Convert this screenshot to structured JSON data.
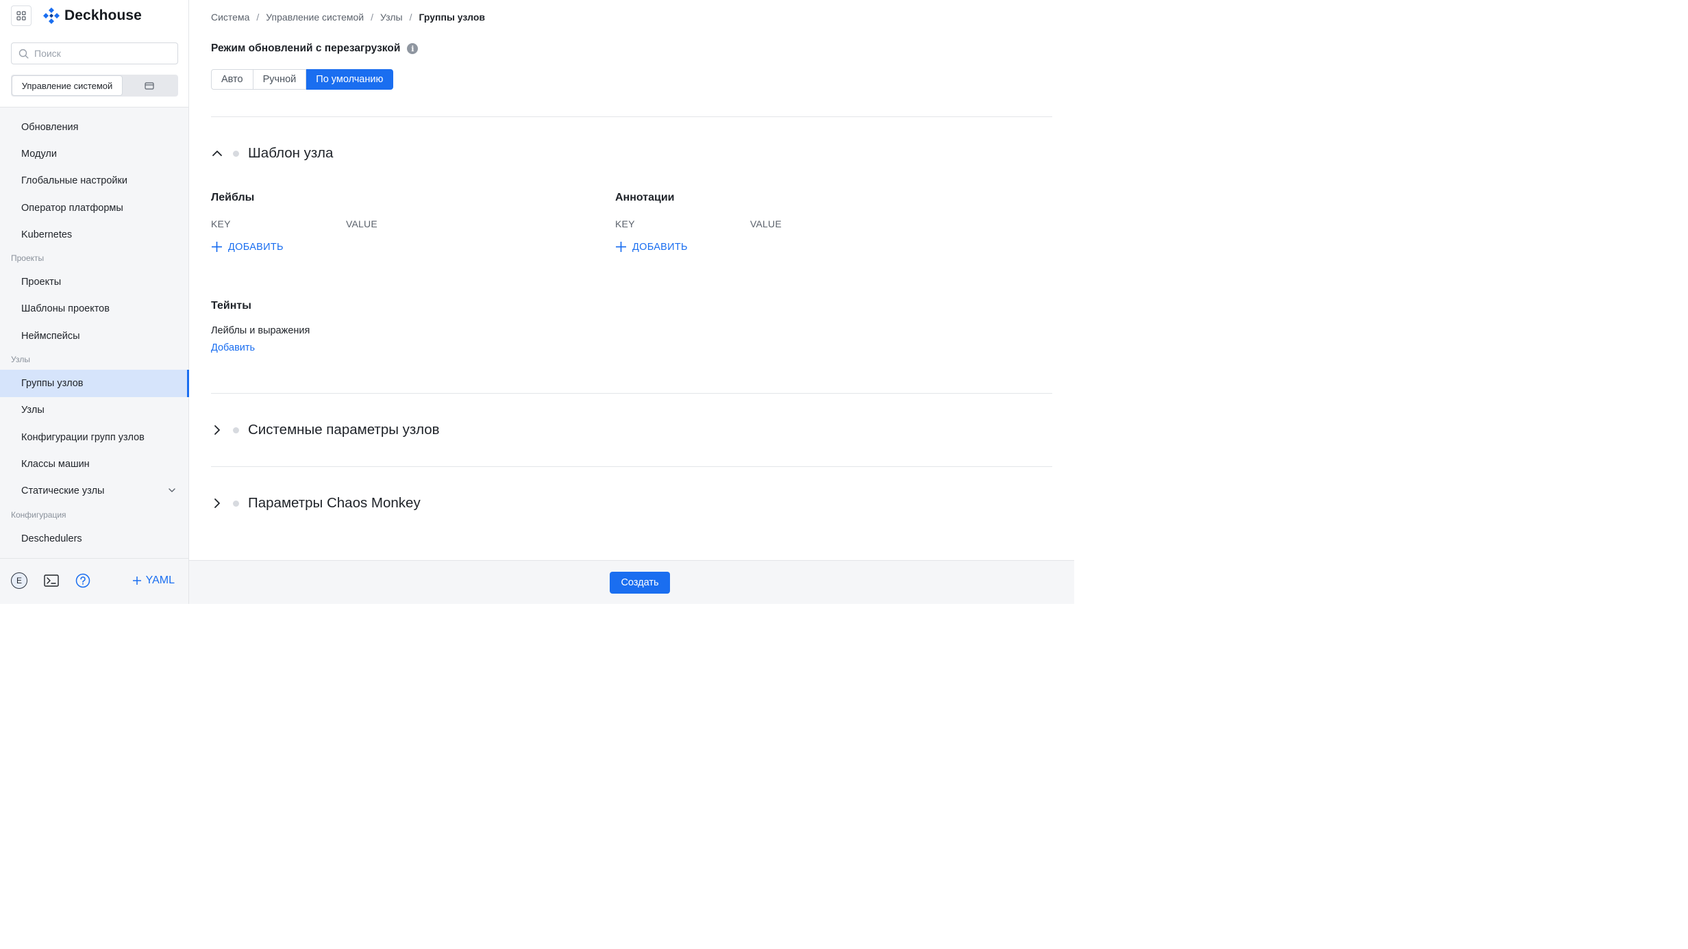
{
  "sidebar": {
    "brand": "Deckhouse",
    "search": {
      "placeholder": "Поиск",
      "value": ""
    },
    "context": {
      "active": "Управление системой"
    },
    "items": [
      {
        "type": "item",
        "label": "Обновления"
      },
      {
        "type": "item",
        "label": "Модули"
      },
      {
        "type": "item",
        "label": "Глобальные настройки"
      },
      {
        "type": "item",
        "label": "Оператор платформы"
      },
      {
        "type": "item",
        "label": "Kubernetes"
      },
      {
        "type": "group",
        "label": "Проекты"
      },
      {
        "type": "item",
        "label": "Проекты"
      },
      {
        "type": "item",
        "label": "Шаблоны проектов"
      },
      {
        "type": "item",
        "label": "Неймспейсы"
      },
      {
        "type": "group",
        "label": "Узлы"
      },
      {
        "type": "item",
        "label": "Группы узлов",
        "active": true
      },
      {
        "type": "item",
        "label": "Узлы"
      },
      {
        "type": "item",
        "label": "Конфигурации групп узлов"
      },
      {
        "type": "item",
        "label": "Классы машин"
      },
      {
        "type": "item",
        "label": "Статические узлы",
        "expandable": true
      },
      {
        "type": "group",
        "label": "Конфигурация"
      },
      {
        "type": "item",
        "label": "Deschedulers"
      }
    ],
    "footer": {
      "avatar_letter": "E",
      "yaml_label": "YAML"
    }
  },
  "breadcrumb": [
    "Система",
    "Управление системой",
    "Узлы",
    "Группы узлов"
  ],
  "reboot_mode": {
    "title": "Режим обновлений с перезагрузкой",
    "options": [
      "Авто",
      "Ручной",
      "По умолчанию"
    ],
    "selected": "По умолчанию"
  },
  "node_template": {
    "title": "Шаблон узла",
    "labels": {
      "title": "Лейблы",
      "key_header": "KEY",
      "value_header": "VALUE",
      "add_label": "ДОБАВИТЬ"
    },
    "annotations": {
      "title": "Аннотации",
      "key_header": "KEY",
      "value_header": "VALUE",
      "add_label": "ДОБАВИТЬ"
    },
    "taints": {
      "title": "Тейнты",
      "description": "Лейблы и выражения",
      "add_link": "Добавить"
    }
  },
  "sections": [
    {
      "title": "Системные параметры узлов",
      "expanded": false
    },
    {
      "title": "Параметры Chaos Monkey",
      "expanded": false
    }
  ],
  "footer": {
    "create_label": "Создать"
  },
  "colors": {
    "accent": "#1a6ef0",
    "active_nav_bg": "#d6e4fb"
  }
}
